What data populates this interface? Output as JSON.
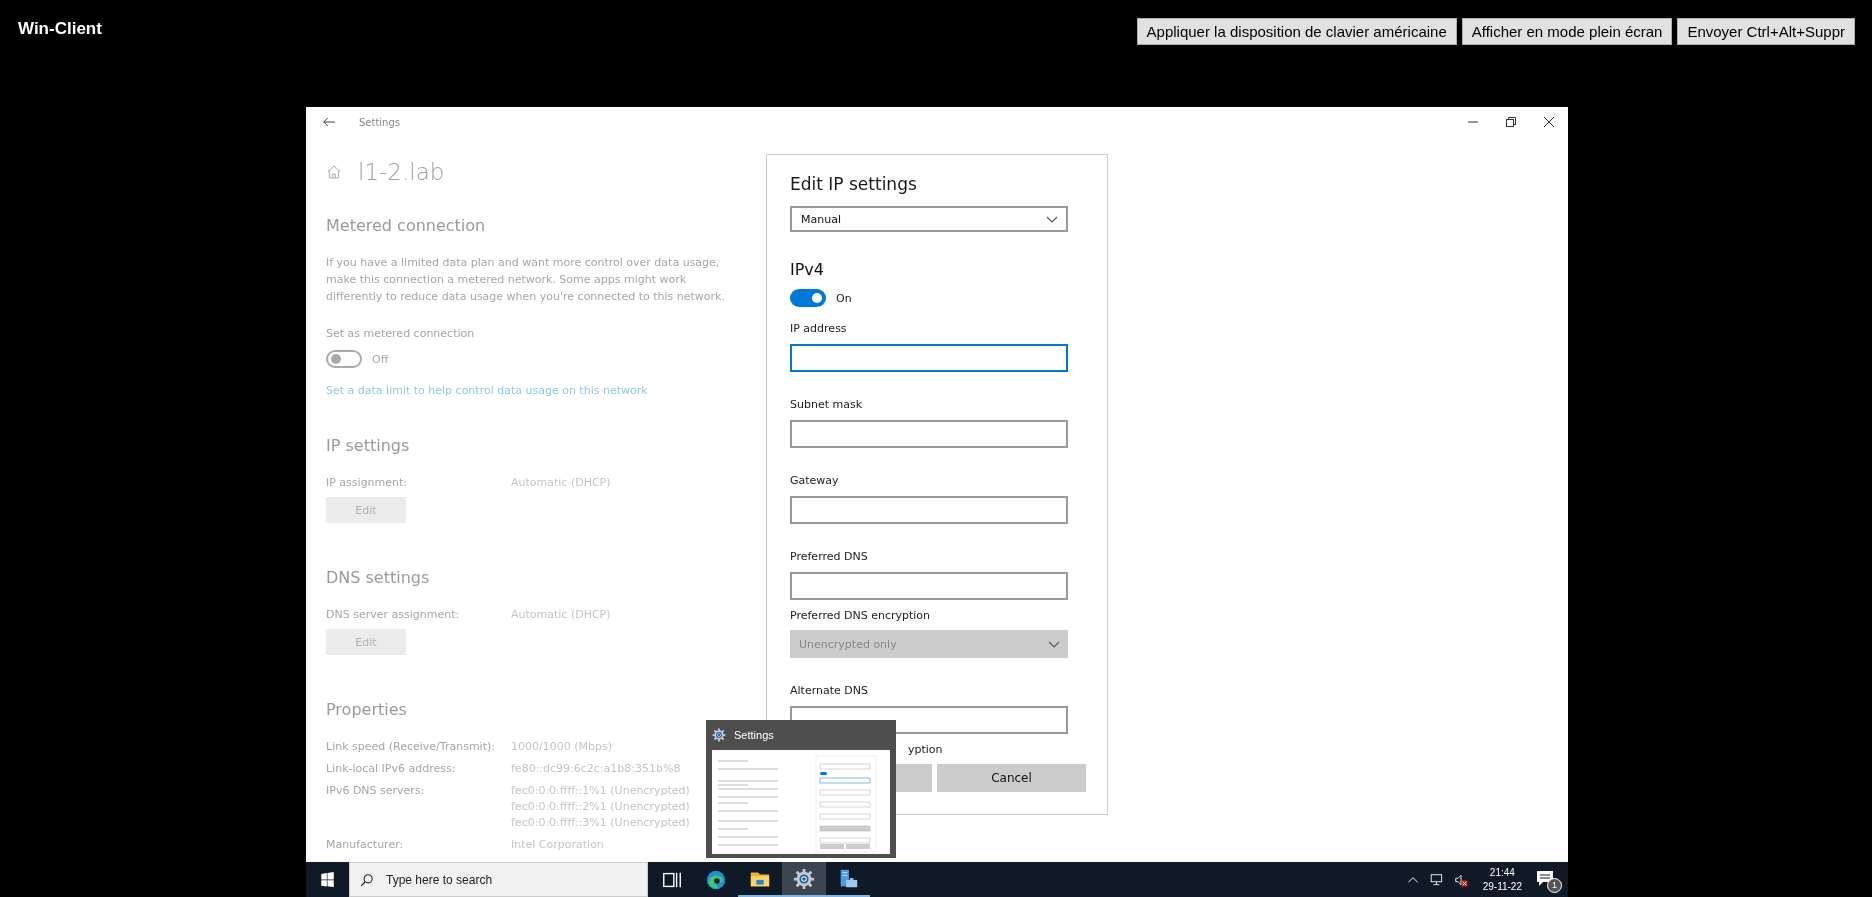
{
  "app": {
    "title": "Win-Client",
    "buttons": [
      "Appliquer la disposition de clavier américaine",
      "Afficher en mode plein écran",
      "Envoyer Ctrl+Alt+Suppr"
    ]
  },
  "window": {
    "title": "Settings",
    "heading": "l1-2.lab"
  },
  "metered": {
    "heading": "Metered connection",
    "description": "If you have a limited data plan and want more control over data usage, make this connection a metered network. Some apps might work differently to reduce data usage when you're connected to this network.",
    "toggle_label": "Set as metered connection",
    "toggle": {
      "on": false,
      "state_text": "Off"
    },
    "link": "Set a data limit to help control data usage on this network"
  },
  "ip_settings": {
    "heading": "IP settings",
    "rows": [
      {
        "label": "IP assignment:",
        "values": [
          "Automatic (DHCP)"
        ]
      }
    ],
    "button": "Edit"
  },
  "dns_settings": {
    "heading": "DNS settings",
    "rows": [
      {
        "label": "DNS server assignment:",
        "values": [
          "Automatic (DHCP)"
        ]
      }
    ],
    "button": "Edit"
  },
  "properties": {
    "heading": "Properties",
    "rows": [
      {
        "label": "Link speed (Receive/Transmit):",
        "values": [
          "1000/1000 (Mbps)"
        ]
      },
      {
        "label": "Link-local IPv6 address:",
        "values": [
          "fe80::dc99:6c2c:a1b8:351b%8"
        ]
      },
      {
        "label": "IPv6 DNS servers:",
        "values": [
          "fec0:0:0:ffff::1%1 (Unencrypted)",
          "fec0:0:0:ffff::2%1 (Unencrypted)",
          "fec0:0:0:ffff::3%1 (Unencrypted)"
        ]
      },
      {
        "label": "Manufacturer:",
        "values": [
          "Intel Corporation"
        ]
      }
    ]
  },
  "dialog": {
    "title": "Edit IP settings",
    "mode": {
      "value": "Manual",
      "disabled": false
    },
    "section": "IPv4",
    "toggle": {
      "on": true,
      "state_text": "On"
    },
    "fields": [
      {
        "kind": "text",
        "label": "IP address",
        "focused": true
      },
      {
        "kind": "text",
        "label": "Subnet mask",
        "focused": false
      },
      {
        "kind": "text",
        "label": "Gateway",
        "focused": false
      },
      {
        "kind": "text",
        "label": "Preferred DNS",
        "focused": false
      },
      {
        "kind": "dropdown",
        "label": "Preferred DNS encryption",
        "value": "Unencrypted only",
        "disabled": true
      },
      {
        "kind": "text",
        "label": "Alternate DNS",
        "focused": false
      },
      {
        "kind": "partial-label",
        "label": "yption"
      }
    ],
    "buttons": [
      {
        "kind": "covered"
      },
      {
        "kind": "labeled",
        "label": "Cancel"
      }
    ]
  },
  "preview": {
    "title": "Settings"
  },
  "taskbar": {
    "search_placeholder": "Type here to search",
    "apps": [
      {
        "kind": "task-view",
        "running": false,
        "selected": false
      },
      {
        "kind": "browser",
        "running": false,
        "selected": false
      },
      {
        "kind": "folder",
        "running": true,
        "selected": false
      },
      {
        "kind": "gear",
        "running": true,
        "selected": true
      },
      {
        "kind": "server",
        "running": true,
        "selected": false
      }
    ],
    "clock": {
      "time": "21:44",
      "date": "29-11-22"
    },
    "notifications": "1"
  }
}
